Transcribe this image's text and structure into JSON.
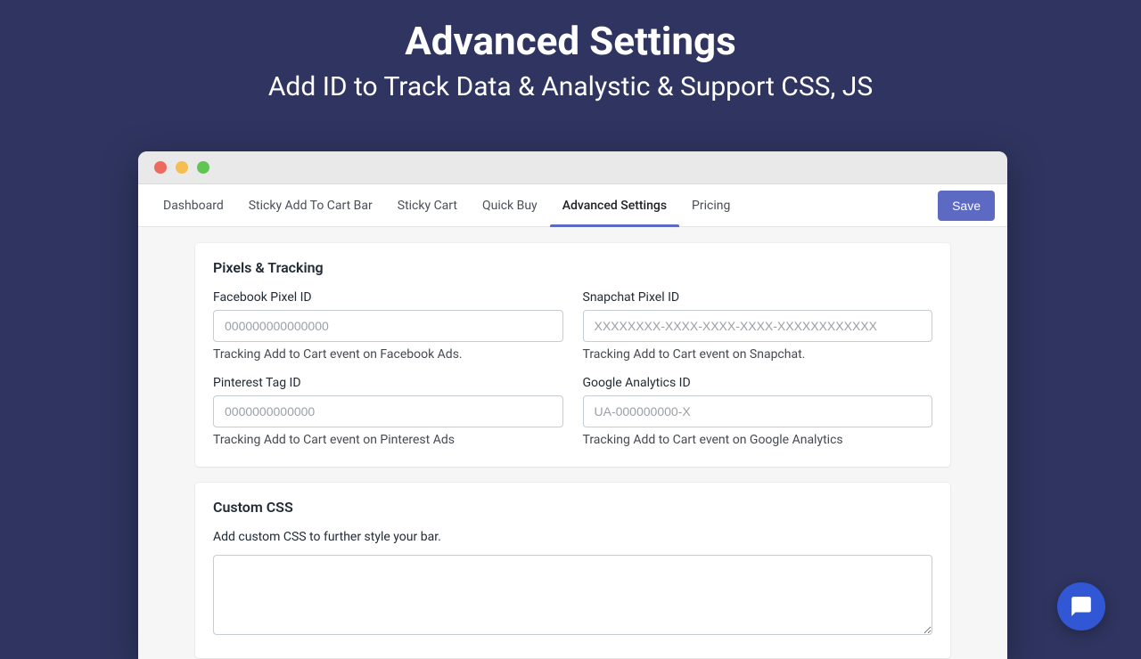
{
  "hero": {
    "title": "Advanced Settings",
    "subtitle": "Add ID to Track Data & Analystic & Support CSS, JS"
  },
  "tabs": {
    "dashboard": "Dashboard",
    "sticky_bar": "Sticky Add To Cart Bar",
    "sticky_cart": "Sticky Cart",
    "quick_buy": "Quick Buy",
    "advanced": "Advanced Settings",
    "pricing": "Pricing"
  },
  "actions": {
    "save": "Save"
  },
  "pixels": {
    "section_title": "Pixels & Tracking",
    "facebook": {
      "label": "Facebook Pixel ID",
      "placeholder": "000000000000000",
      "hint": "Tracking Add to Cart event on Facebook Ads."
    },
    "snapchat": {
      "label": "Snapchat Pixel ID",
      "placeholder": "XXXXXXXX-XXXX-XXXX-XXXX-XXXXXXXXXXXX",
      "hint": "Tracking Add to Cart event on Snapchat."
    },
    "pinterest": {
      "label": "Pinterest Tag ID",
      "placeholder": "0000000000000",
      "hint": "Tracking Add to Cart event on Pinterest Ads"
    },
    "ga": {
      "label": "Google Analytics ID",
      "placeholder": "UA-000000000-X",
      "hint": "Tracking Add to Cart event on Google Analytics"
    }
  },
  "custom_css": {
    "section_title": "Custom CSS",
    "description": "Add custom CSS to further style your bar."
  }
}
